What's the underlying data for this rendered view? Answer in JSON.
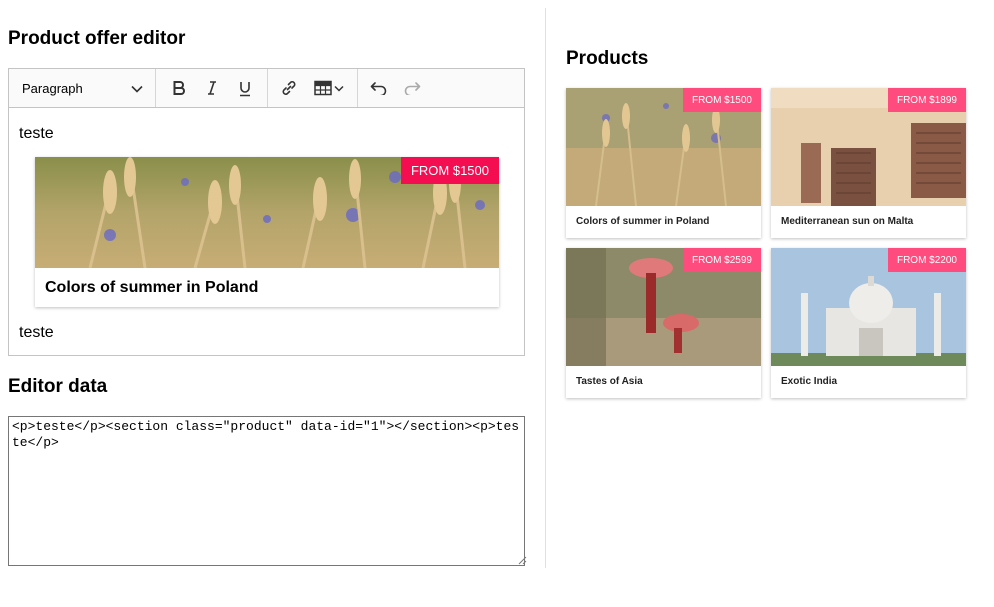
{
  "editor": {
    "title": "Product offer editor",
    "heading_dropdown": "Paragraph",
    "paragraph_before": "teste",
    "paragraph_after": "teste",
    "embedded_product": {
      "name": "Colors of summer in Poland",
      "price": "FROM $1500"
    }
  },
  "editor_data": {
    "title": "Editor data",
    "content": "<p>teste</p><section class=\"product\" data-id=\"1\"></section><p>teste</p>"
  },
  "products": {
    "title": "Products",
    "items": [
      {
        "name": "Colors of summer in Poland",
        "price": "FROM $1500"
      },
      {
        "name": "Mediterranean sun on Malta",
        "price": "FROM $1899"
      },
      {
        "name": "Tastes of Asia",
        "price": "FROM $2599"
      },
      {
        "name": "Exotic India",
        "price": "FROM $2200"
      }
    ]
  },
  "colors": {
    "badge_large": "#f50d52",
    "badge_small": "#ff4b7e"
  },
  "icons": [
    "chevron-down-icon",
    "bold-icon",
    "italic-icon",
    "underline-icon",
    "link-icon",
    "table-icon",
    "undo-icon",
    "redo-icon"
  ]
}
